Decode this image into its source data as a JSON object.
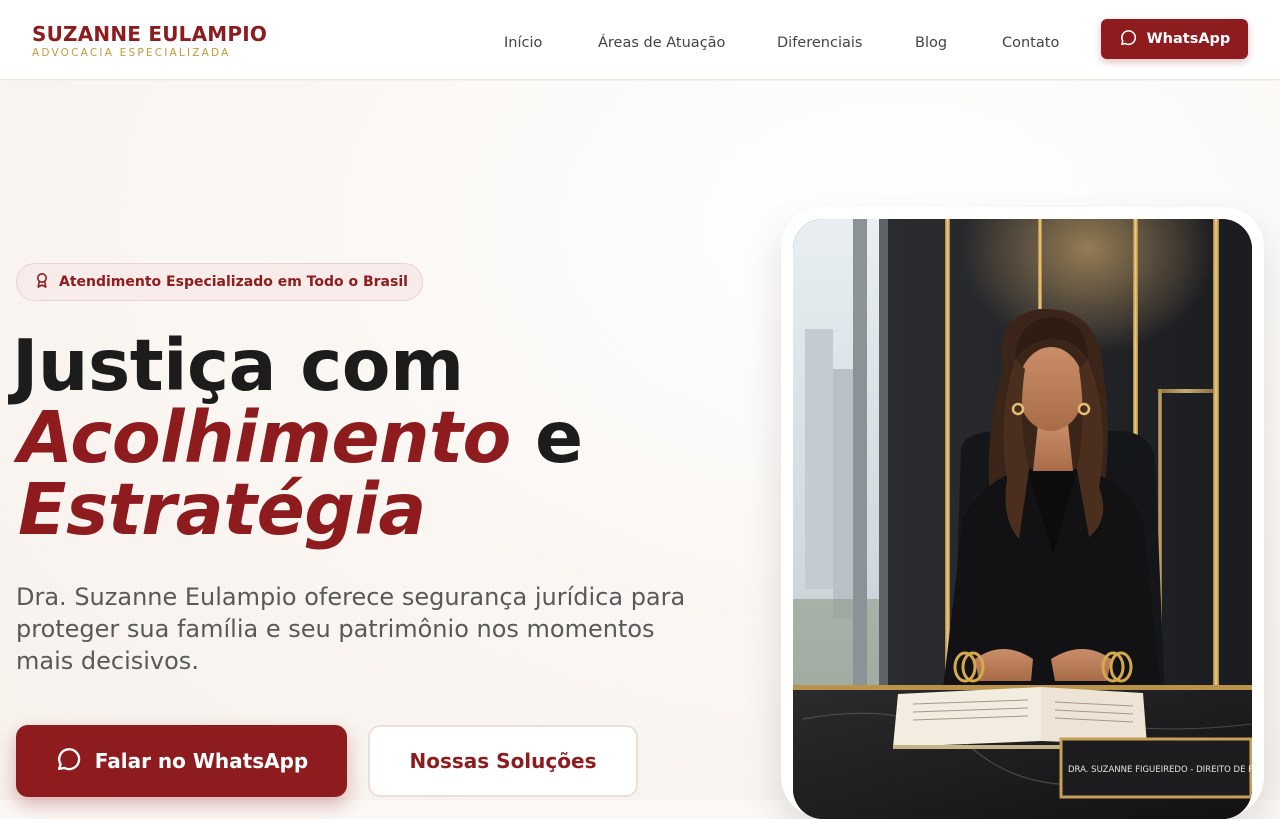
{
  "brand": {
    "name": "SUZANNE EULAMPIO",
    "tagline": "ADVOCACIA ESPECIALIZADA"
  },
  "nav": {
    "items": [
      {
        "label": "Início"
      },
      {
        "label": "Áreas de Atuação"
      },
      {
        "label": "Diferenciais"
      },
      {
        "label": "Blog"
      },
      {
        "label": "Contato"
      }
    ],
    "cta_label": "WhatsApp"
  },
  "hero": {
    "badge": "Atendimento Especializado em Todo o Brasil",
    "headline": {
      "line1": "Justiça com",
      "accent1": "Acolhimento",
      "connector": " e",
      "accent2": "Estratégia"
    },
    "lead": "Dra. Suzanne Eulampio oferece segurança jurídica para proteger sua família e seu patrimônio nos momentos mais decisivos.",
    "primary_cta": "Falar no WhatsApp",
    "secondary_cta": "Nossas Soluções"
  },
  "photo": {
    "nameplate": "DRA. SUZANNE FIGUEIREDO - DIREITO DE FAMÍLIA"
  },
  "icons": {
    "whatsapp": "chat-bubble-icon",
    "badge": "award-ribbon-icon"
  },
  "colors": {
    "brand_red": "#8e1b1e",
    "gold": "#c49a3a",
    "heading": "#1c1c1c",
    "body_text": "#595959"
  }
}
